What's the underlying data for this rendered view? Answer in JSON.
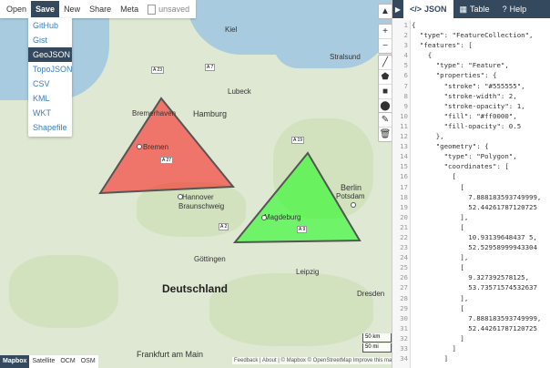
{
  "menu": {
    "items": [
      "Open",
      "Save",
      "New",
      "Share",
      "Meta"
    ],
    "unsaved": "unsaved",
    "save_options": [
      "GitHub",
      "Gist",
      "GeoJSON",
      "TopoJSON",
      "CSV",
      "KML",
      "WKT",
      "Shapefile"
    ]
  },
  "map": {
    "cities": {
      "hamburg": "Hamburg",
      "bremen": "Bremen",
      "bremerhaven": "Bremerhaven",
      "lubeck": "Lubeck",
      "kiel": "Kiel",
      "stralsund": "Stralsund",
      "berlin": "Berlin",
      "potsdam": "Potsdam",
      "magdeburg": "Magdeburg",
      "hannover": "Hannover",
      "braunschweig": "Braunschweig",
      "gottingen": "Göttingen",
      "leipzig": "Leipzig",
      "dresden": "Dresden",
      "frankfurt": "Frankfurt am Main",
      "deutschland": "Deutschland"
    },
    "roads": [
      "A 23",
      "A 7",
      "A 19",
      "A 9",
      "A 27",
      "A 2"
    ],
    "scale": [
      "50 km",
      "50 mi"
    ],
    "attribution": "Feedback | About | © Mapbox © OpenStreetMap Improve this map",
    "layers": [
      "Mapbox",
      "Satellite",
      "OCM",
      "OSM"
    ],
    "shapes": [
      {
        "name": "red triangle",
        "fill": "#ff0000",
        "stroke": "#555555"
      },
      {
        "name": "green triangle",
        "fill": "#00ff00",
        "stroke": "#555555"
      }
    ]
  },
  "panel": {
    "tabs": [
      "JSON",
      "Table",
      "Help"
    ],
    "lines": [
      "{",
      "  \"type\": \"FeatureCollection\",",
      "  \"features\": [",
      "    {",
      "      \"type\": \"Feature\",",
      "      \"properties\": {",
      "        \"stroke\": \"#555555\",",
      "        \"stroke-width\": 2,",
      "        \"stroke-opacity\": 1,",
      "        \"fill\": \"#ff0000\",",
      "        \"fill-opacity\": 0.5",
      "      },",
      "      \"geometry\": {",
      "        \"type\": \"Polygon\",",
      "        \"coordinates\": [",
      "          [",
      "            [",
      "              7.888183593749999,",
      "              52.44261787120725",
      "            ],",
      "            [",
      "              10.93139648437 5,",
      "              52.52958999943304",
      "            ],",
      "            [",
      "              9.327392578125,",
      "              53.73571574532637",
      "            ],",
      "            [",
      "              7.888183593749999,",
      "              52.44261787120725",
      "            ]",
      "          ]",
      "        ]"
    ]
  }
}
